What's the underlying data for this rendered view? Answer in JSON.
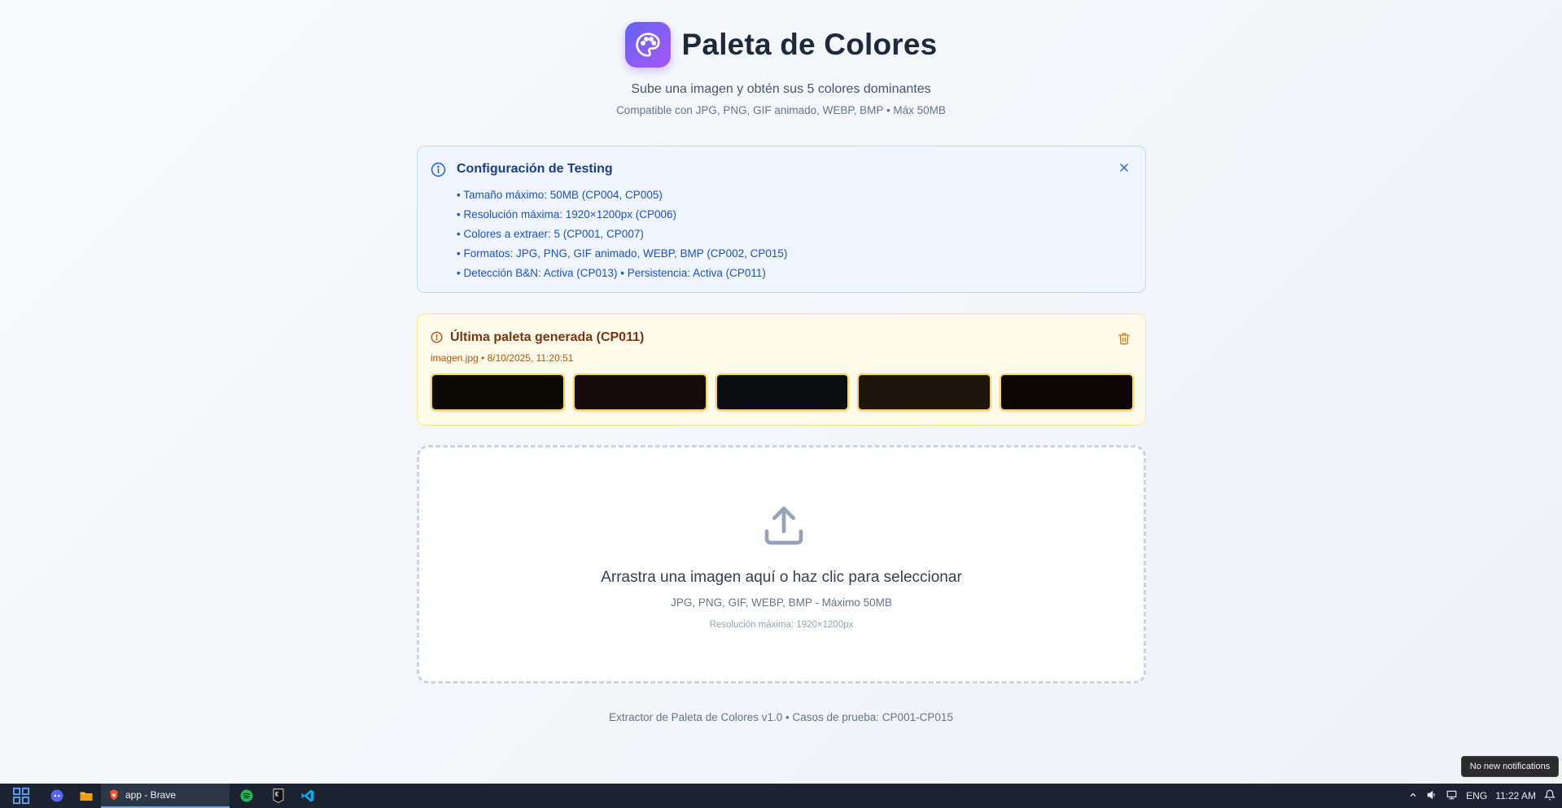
{
  "header": {
    "title": "Paleta de Colores",
    "subtitle": "Sube una imagen y obtén sus 5 colores dominantes",
    "compat": "Compatible con JPG, PNG, GIF animado, WEBP, BMP • Máx 50MB"
  },
  "info": {
    "title": "Configuración de Testing",
    "items": [
      "• Tamaño máximo: 50MB (CP004, CP005)",
      "• Resolución máxima: 1920×1200px (CP006)",
      "• Colores a extraer: 5 (CP001, CP007)",
      "• Formatos: JPG, PNG, GIF animado, WEBP, BMP (CP002, CP015)",
      "• Detección B&N: Activa (CP013) • Persistencia: Activa (CP011)"
    ]
  },
  "last": {
    "title": "Última paleta generada (CP011)",
    "meta": "imagen.jpg • 8/10/2025, 11:20:51",
    "swatches": [
      "#0c0a05",
      "#150b0b",
      "#0a0c0d",
      "#1e160d",
      "#0b0304"
    ]
  },
  "drop": {
    "text": "Arrastra una imagen aquí o haz clic para seleccionar",
    "formats": "JPG, PNG, GIF, WEBP, BMP - Máximo 50MB",
    "resolution": "Resolución máxima: 1920×1200px"
  },
  "footer": "Extractor de Paleta de Colores v1.0 • Casos de prueba: CP001-CP015",
  "toast": "No new notifications",
  "taskbar": {
    "app_label": "app - Brave",
    "lang": "ENG",
    "time": "11:22 AM"
  },
  "colors": {
    "accent": "#7c3aed",
    "info_text": "#1d4ed8",
    "warning_text": "#b45309"
  }
}
